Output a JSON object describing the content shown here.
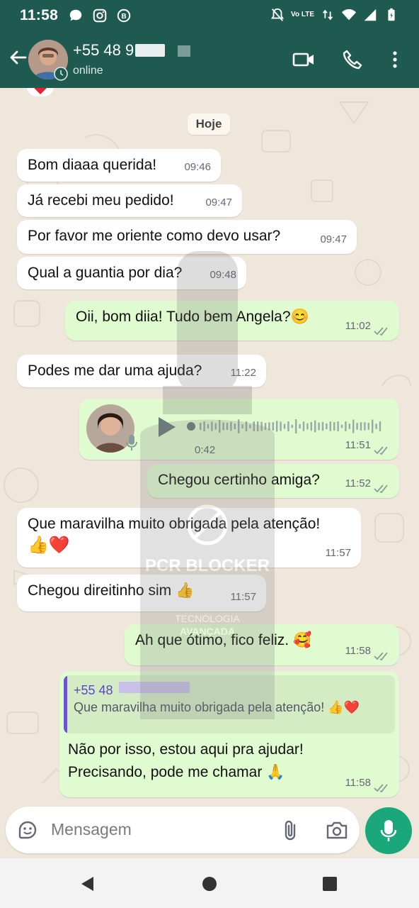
{
  "status_bar": {
    "time": "11:58",
    "network_label": "Vo LTE"
  },
  "header": {
    "contact_name": "+55 48 9",
    "contact_status": "online",
    "icons": [
      "back-arrow-icon",
      "video-call-icon",
      "phone-call-icon",
      "more-options-icon"
    ]
  },
  "chat": {
    "day_label": "Hoje",
    "messages": [
      {
        "dir": "in",
        "text": "Bom diaaa querida!",
        "time": "09:46"
      },
      {
        "dir": "in",
        "text": "Já recebi meu pedido!",
        "time": "09:47"
      },
      {
        "dir": "in",
        "text": "Por favor me oriente como devo usar?",
        "time": "09:47"
      },
      {
        "dir": "in",
        "text": "Qual a guantia por dia?",
        "time": "09:48"
      },
      {
        "dir": "out",
        "text": "Oii, bom diia! Tudo bem Angela?😊",
        "time": "11:02"
      },
      {
        "dir": "in",
        "text": "Podes me dar uma ajuda?",
        "time": "11:22"
      },
      {
        "dir": "out",
        "type": "voice",
        "duration": "0:42",
        "time": "11:51"
      },
      {
        "dir": "out",
        "text": "Chegou certinho amiga?",
        "time": "11:52"
      },
      {
        "dir": "in",
        "text": "Que maravilha muito obrigada pela atenção!",
        "text2": "👍❤️",
        "time": "11:57"
      },
      {
        "dir": "in",
        "text": "Chegou direitinho sim 👍",
        "time": "11:57"
      },
      {
        "dir": "out",
        "text": "Ah que ótimo, fico feliz. 🥰",
        "time": "11:58"
      },
      {
        "dir": "out",
        "quote_name": "+55 48",
        "quote_text": "Que maravilha muito obrigada pela atenção! 👍❤️",
        "text": "Não por isso, estou aqui pra ajudar!",
        "text2": "Precisando, pode me chamar 🙏",
        "time": "11:58"
      }
    ],
    "watermark": {
      "brand": "PCR BLOCKER",
      "line1": "TECNOLOGIA",
      "line2": "AVANÇADA"
    }
  },
  "composer": {
    "placeholder": "Mensagem"
  },
  "colors": {
    "header": "#1f5a50",
    "outgoing": "#e0fbcf",
    "incoming": "#ffffff",
    "accent": "#1aa77a"
  }
}
